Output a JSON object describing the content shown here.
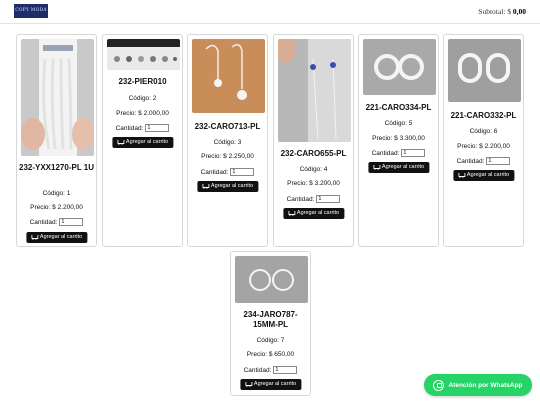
{
  "header": {
    "logo_text": "COPY MODA",
    "subtotal_label": "Subtotal: $",
    "subtotal_value": "0,00"
  },
  "products": [
    {
      "name": "232-YXX1270-PL 1U",
      "codigo": "Código: 1",
      "precio": "Precio: $ 2.200,00",
      "qty_label": "Cantidad:",
      "qty": "1",
      "button": "Agregar al carrito"
    },
    {
      "name": "232-PIER010",
      "codigo": "Código: 2",
      "precio": "Precio: $ 2.000,00",
      "qty_label": "Cantidad:",
      "qty": "1",
      "button": "Agregar al carrito"
    },
    {
      "name": "232-CARO713-PL",
      "codigo": "Código: 3",
      "precio": "Precio: $ 2.250,00",
      "qty_label": "Cantidad:",
      "qty": "1",
      "button": "Agregar al carrito"
    },
    {
      "name": "232-CARO655-PL",
      "codigo": "Código: 4",
      "precio": "Precio: $ 3.200,00",
      "qty_label": "Cantidad:",
      "qty": "1",
      "button": "Agregar al carrito"
    },
    {
      "name": "221-CARO334-PL",
      "codigo": "Código: 5",
      "precio": "Precio: $ 3.300,00",
      "qty_label": "Cantidad:",
      "qty": "1",
      "button": "Agregar al carrito"
    },
    {
      "name": "221-CARO332-PL",
      "codigo": "Código: 6",
      "precio": "Precio: $ 2.200,00",
      "qty_label": "Cantidad:",
      "qty": "1",
      "button": "Agregar al carrito"
    },
    {
      "name": "234-JARO787-15MM-PL",
      "codigo": "Código: 7",
      "precio": "Precio: $ 650,00",
      "qty_label": "Cantidad:",
      "qty": "1",
      "button": "Agregar al carrito"
    }
  ],
  "whatsapp": {
    "label": "Atención por WhatsApp"
  },
  "colors": {
    "button": "#111111",
    "whatsapp": "#25d366",
    "logo_bg": "#1f2d6b"
  }
}
